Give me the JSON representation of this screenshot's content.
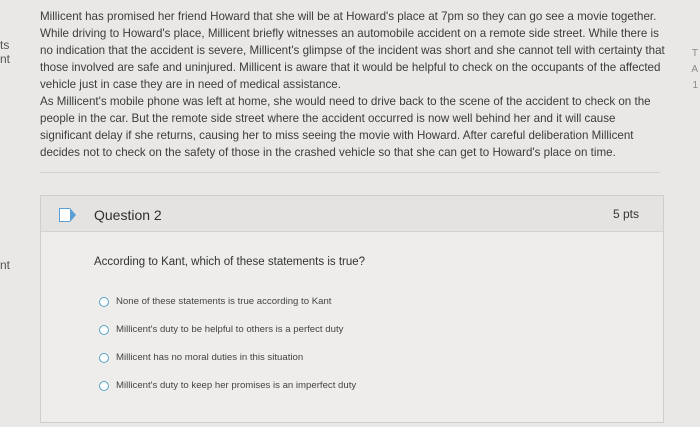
{
  "side_fragments": {
    "left": [
      "ts",
      "nt",
      "nt"
    ],
    "right": [
      "T",
      "A",
      "1"
    ]
  },
  "scenario": {
    "paragraph_1": "Millicent has promised her friend Howard that she will be at Howard's place at 7pm so they can go see a movie together. While driving to Howard's place, Millicent briefly witnesses an automobile accident on a remote side street. While there is no indication that the accident is severe, Millicent's glimpse of the incident was short and she cannot tell with certainty that those involved are safe and uninjured. Millicent is aware that it would be helpful to check on the occupants of the affected vehicle just in case they are in need of medical assistance.",
    "paragraph_2": "As Millicent's mobile phone was left at home, she would need to drive back to the scene of the accident to check on the people in the car. But the remote side street where the accident occurred is now well behind her and it will cause significant delay if she returns, causing her to miss seeing the movie with Howard. After careful deliberation Millicent decides not to check on the safety of those in the crashed vehicle so that she can get to Howard's place on time."
  },
  "question": {
    "title": "Question 2",
    "points": "5 pts",
    "prompt": "According to Kant, which of these statements is true?",
    "options": [
      "None of these statements is true according to Kant",
      "Millicent's duty to be helpful to others is a perfect duty",
      "Millicent has no moral duties in this situation",
      "Millicent's duty to keep her promises is an imperfect duty"
    ]
  },
  "colors": {
    "accent": "#5a9fd6",
    "radio": "#5aa0c9",
    "background": "#e9e8e6"
  }
}
